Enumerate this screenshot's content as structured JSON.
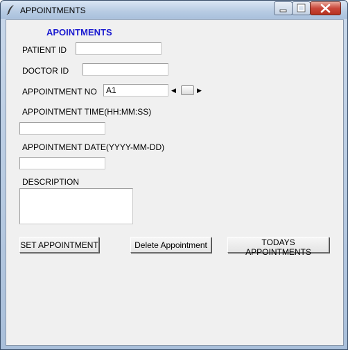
{
  "window": {
    "title": "APPOINTMENTS",
    "icon": "feather-icon",
    "controls": [
      "minimize-icon",
      "maximize-icon",
      "close-icon"
    ]
  },
  "form": {
    "heading": "APOINTMENTS",
    "patient_id": {
      "label": "PATIENT ID",
      "value": ""
    },
    "doctor_id": {
      "label": "DOCTOR ID",
      "value": ""
    },
    "appointment_no": {
      "label": "APPOINTMENT NO",
      "value": "A1"
    },
    "appointment_time": {
      "label": "APPOINTMENT TIME(HH:MM:SS)",
      "value": ""
    },
    "appointment_date": {
      "label": "APPOINTMENT DATE(YYYY-MM-DD)",
      "value": ""
    },
    "description": {
      "label": "DESCRIPTION",
      "value": ""
    }
  },
  "buttons": {
    "set": "SET APPOINTMENT",
    "delete": "Delete Appointment",
    "todays": "TODAYS APPOINTMENTS"
  },
  "colors": {
    "heading": "#1a1ad0",
    "client_bg": "#f0f0f0",
    "close_button": "#c9473a"
  }
}
